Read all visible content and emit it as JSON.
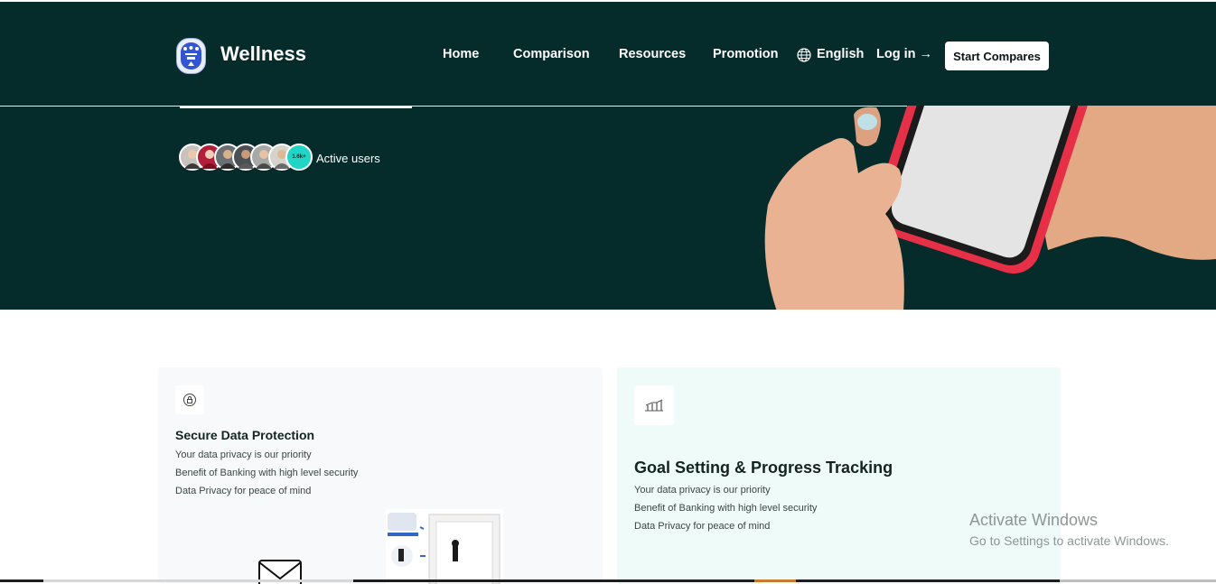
{
  "header": {
    "brand": "Wellness",
    "nav": [
      "Home",
      "Comparison",
      "Resources",
      "Promotion"
    ],
    "language": "English",
    "login": "Log in →",
    "cta": "Start Compares"
  },
  "hero": {
    "users_count_badge": "1.6k+",
    "active_users_label": "Active users",
    "image_icon": "hands-holding-phone-image"
  },
  "features": [
    {
      "icon": "shield-lock-icon",
      "title": "Secure Data Protection",
      "lines": [
        "Your data privacy is our priority",
        "Benefit of Banking with high level security",
        "Data Privacy for peace of mind"
      ]
    },
    {
      "icon": "growth-chart-icon",
      "title": "Goal Setting & Progress Tracking",
      "lines": [
        "Your data privacy is our priority",
        "Benefit of Banking with high level security",
        "Data Privacy for peace of mind"
      ]
    }
  ],
  "watermark": {
    "title": "Activate Windows",
    "subtitle": "Go to Settings to activate Windows."
  },
  "colors": {
    "hero_background": "#062b2b",
    "accent_teal": "#20d4c6",
    "phone_case": "#e53048"
  }
}
